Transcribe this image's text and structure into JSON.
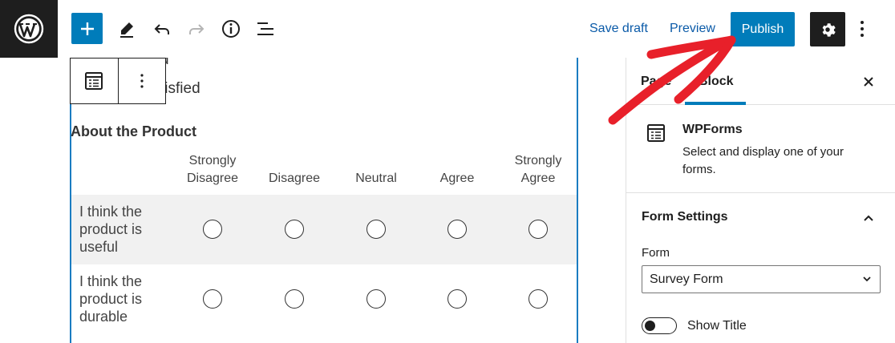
{
  "topbar": {
    "logo_icon": "wordpress-logo",
    "add_icon": "plus-icon",
    "tools": [
      "pencil-icon",
      "undo-icon",
      "redo-icon",
      "info-icon",
      "list-view-icon"
    ],
    "save_draft": "Save draft",
    "preview": "Preview",
    "publish": "Publish",
    "settings_icon": "gear-icon",
    "more_icon": "vertical-ellipsis-icon",
    "accent_color": "#007cba"
  },
  "editor": {
    "partial_line": "d",
    "satisfied_fragment": "tisfied",
    "section_title": "About the Product",
    "columns": [
      "Strongly Disagree",
      "Disagree",
      "Neutral",
      "Agree",
      "Strongly Agree"
    ],
    "columns_display": [
      [
        "Strongly",
        "Disagree"
      ],
      [
        "",
        "Disagree"
      ],
      [
        "",
        "Neutral"
      ],
      [
        "",
        "Agree"
      ],
      [
        "Strongly",
        "Agree"
      ]
    ],
    "rows": [
      {
        "label_lines": [
          "I think the",
          "product is",
          "useful"
        ]
      },
      {
        "label_lines": [
          "I think the",
          "product is",
          "durable"
        ]
      }
    ]
  },
  "sidebar": {
    "tab_page": "Page",
    "tab_block": "Block",
    "block_name": "WPForms",
    "block_desc": "Select and display one of your forms.",
    "panel_title": "Form Settings",
    "form_label": "Form",
    "form_value": "Survey Form",
    "show_title_label": "Show Title",
    "show_title_on": false
  },
  "annotation": {
    "color": "#e8202a"
  }
}
